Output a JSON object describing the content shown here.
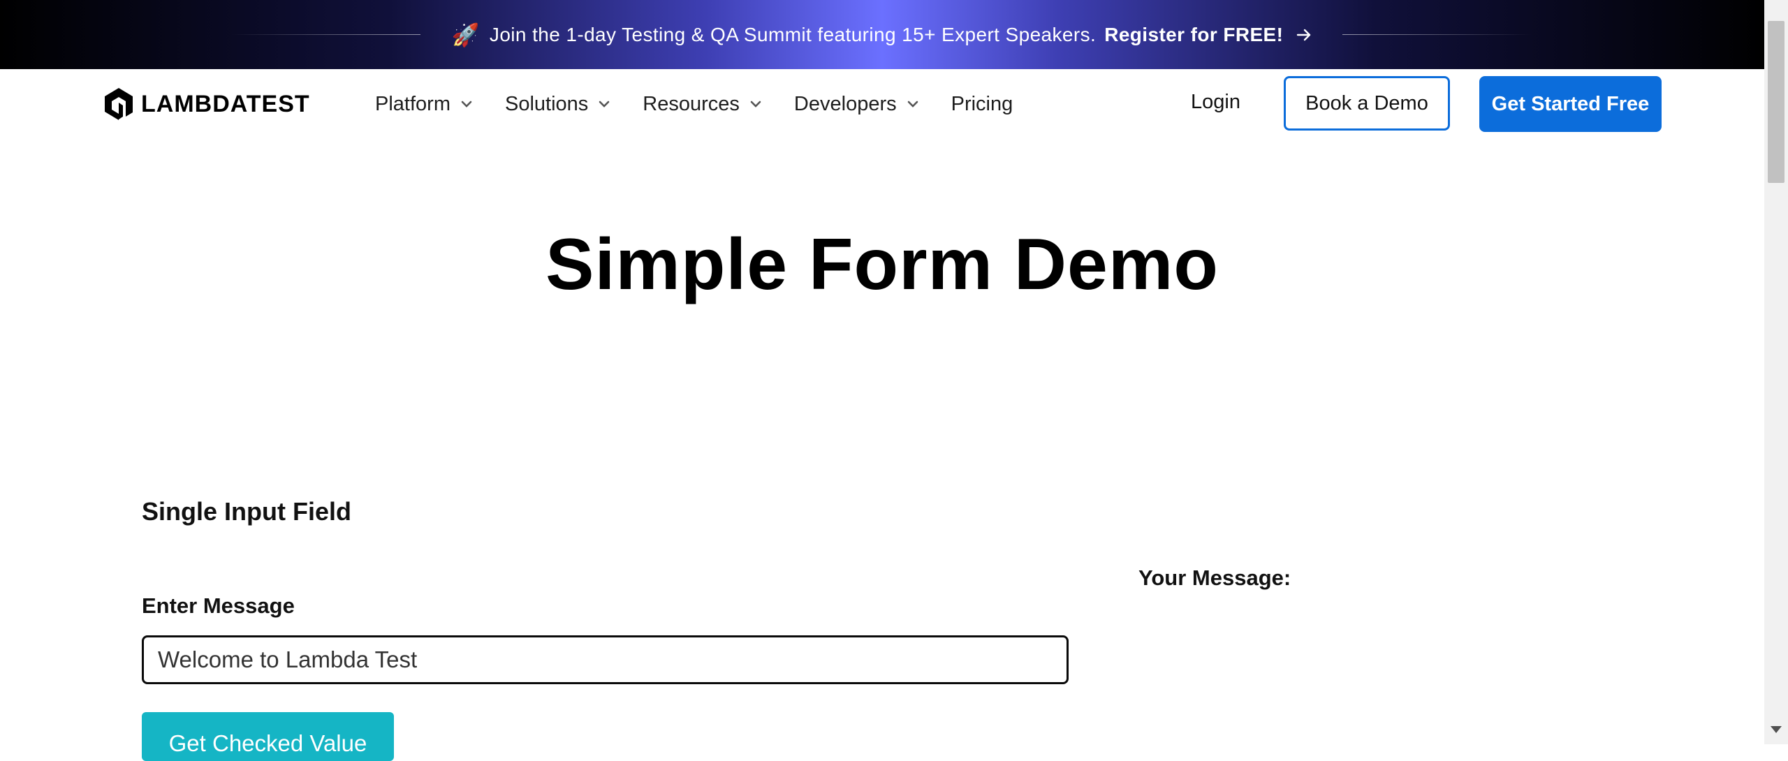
{
  "banner": {
    "icon": "rocket-icon",
    "text": "Join the 1-day Testing & QA Summit featuring 15+ Expert Speakers.",
    "cta": "Register for FREE!"
  },
  "nav": {
    "logo_text": "LAMBDATEST",
    "items": [
      {
        "label": "Platform",
        "has_dropdown": true
      },
      {
        "label": "Solutions",
        "has_dropdown": true
      },
      {
        "label": "Resources",
        "has_dropdown": true
      },
      {
        "label": "Developers",
        "has_dropdown": true
      },
      {
        "label": "Pricing",
        "has_dropdown": false
      }
    ],
    "login": "Login",
    "book_demo": "Book a Demo",
    "get_started": "Get Started Free"
  },
  "page": {
    "title": "Simple Form Demo",
    "section_title": "Single Input Field",
    "field_label": "Enter Message",
    "input_value": "Welcome to Lambda Test",
    "submit": "Get Checked Value",
    "your_message_label": "Your Message:"
  },
  "colors": {
    "primary": "#0c6ddb",
    "submit": "#15b5c5",
    "banner_glow": "#6b70ff"
  }
}
